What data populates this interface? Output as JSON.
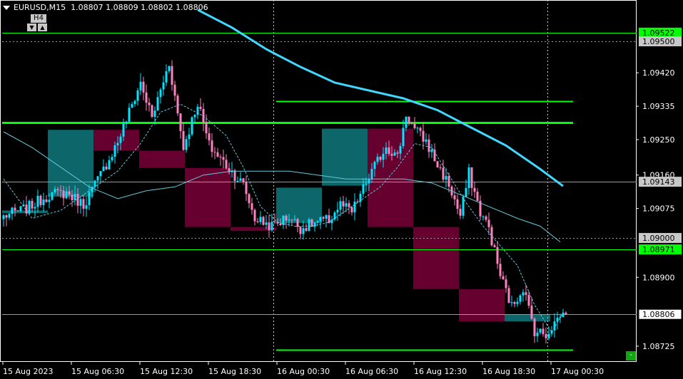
{
  "header": {
    "symbol": "EURUSD,M15",
    "ohlc": "1.08807 1.08809 1.08802 1.08806"
  },
  "timeframe": {
    "label": "H4",
    "down_glyph": "▼",
    "up_glyph": "▲"
  },
  "corner_button": {
    "label": "-"
  },
  "colors": {
    "background": "#000000",
    "axis_text": "#ffffff",
    "bull_candle": "#00e5ff",
    "bear_candle": "#ff80c0",
    "h4_bull_box": "#0d6b70",
    "h4_bear_box": "#6b0030",
    "level_green": "#00ff00",
    "ma_slow": "#40d8ff",
    "ma_mid": "#66c8dc",
    "ma_fast": "#66c8dc",
    "current_price_label": "#ffffff",
    "green_label_bg": "#00ff00"
  },
  "chart_data": {
    "type": "candlestick",
    "symbol": "EURUSD",
    "timeframe": "M15",
    "ylim": [
      1.08685,
      1.09605
    ],
    "x_tick_labels": [
      "15 Aug 2023",
      "15 Aug 06:30",
      "15 Aug 12:30",
      "15 Aug 18:30",
      "16 Aug 00:30",
      "16 Aug 06:30",
      "16 Aug 12:30",
      "16 Aug 18:30",
      "17 Aug 00:30"
    ],
    "y_tick_labels": [
      "1.09420",
      "1.09335",
      "1.09250",
      "1.09160",
      "1.09075",
      "1.08900",
      "1.08725"
    ],
    "price_labels": [
      {
        "text": "1.09522",
        "value": 1.09522,
        "style": "green"
      },
      {
        "text": "1.09500",
        "value": 1.095,
        "style": "white"
      },
      {
        "text": "1.09143",
        "value": 1.09143,
        "style": "white"
      },
      {
        "text": "1.09000",
        "value": 1.09,
        "style": "white"
      },
      {
        "text": "1.08971",
        "value": 1.08971,
        "style": "green"
      },
      {
        "text": "1.08806",
        "value": 1.08806,
        "style": "current"
      }
    ],
    "horizontal_levels": [
      {
        "value": 1.09522,
        "color": "#00ff00",
        "width": 1,
        "from_bar": 0,
        "to_bar": null
      },
      {
        "value": 1.095,
        "color": "#9a9a9a",
        "width": 1,
        "dash": true,
        "from_bar": 0,
        "to_bar": null
      },
      {
        "value": 1.09348,
        "color": "#00ff00",
        "width": 2,
        "from_bar": 96,
        "to_bar": 200
      },
      {
        "value": 1.09293,
        "color": "#00ff00",
        "width": 3,
        "from_bar": 0,
        "to_bar": 200
      },
      {
        "value": 1.09143,
        "color": "#9a9a9a",
        "width": 1,
        "from_bar": 0,
        "to_bar": null
      },
      {
        "value": 1.09,
        "color": "#9a9a9a",
        "width": 1,
        "dash": true,
        "from_bar": 0,
        "to_bar": null
      },
      {
        "value": 1.08971,
        "color": "#00ff00",
        "width": 1,
        "from_bar": 0,
        "to_bar": null
      },
      {
        "value": 1.08806,
        "color": "#9a9a9a",
        "width": 1,
        "from_bar": 0,
        "to_bar": null
      },
      {
        "value": 1.08715,
        "color": "#00ff00",
        "width": 2,
        "from_bar": 96,
        "to_bar": 200
      }
    ],
    "vertical_separators": [
      "16 Aug 00:00",
      "17 Aug 00:00"
    ],
    "h4_boxes": [
      {
        "open": 1.0907,
        "close": 1.09063,
        "bull": true
      },
      {
        "open": 1.09105,
        "close": 1.09275,
        "bull": true
      },
      {
        "open": 1.09275,
        "close": 1.09222,
        "bull": false
      },
      {
        "open": 1.09222,
        "close": 1.09178,
        "bull": false
      },
      {
        "open": 1.09178,
        "close": 1.09028,
        "bull": false
      },
      {
        "open": 1.09028,
        "close": 1.09018,
        "bull": false
      },
      {
        "open": 1.09038,
        "close": 1.09128,
        "bull": true
      },
      {
        "open": 1.09133,
        "close": 1.09278,
        "bull": true
      },
      {
        "open": 1.09278,
        "close": 1.09028,
        "bull": false
      },
      {
        "open": 1.09028,
        "close": 1.0887,
        "bull": false
      },
      {
        "open": 1.0887,
        "close": 1.08788,
        "bull": false
      },
      {
        "open": 1.08788,
        "close": 1.08806,
        "bull": true
      }
    ],
    "anchors": [
      [
        0,
        1.09055
      ],
      [
        8,
        1.09075
      ],
      [
        16,
        1.0911
      ],
      [
        22,
        1.09115
      ],
      [
        28,
        1.09085
      ],
      [
        34,
        1.0916
      ],
      [
        40,
        1.09245
      ],
      [
        48,
        1.09395
      ],
      [
        52,
        1.09305
      ],
      [
        58,
        1.09445
      ],
      [
        63,
        1.0923
      ],
      [
        68,
        1.09345
      ],
      [
        72,
        1.09235
      ],
      [
        78,
        1.09185
      ],
      [
        84,
        1.09135
      ],
      [
        88,
        1.0905
      ],
      [
        94,
        1.0903
      ],
      [
        100,
        1.09055
      ],
      [
        104,
        1.09025
      ],
      [
        110,
        1.0904
      ],
      [
        114,
        1.09045
      ],
      [
        118,
        1.09085
      ],
      [
        122,
        1.09065
      ],
      [
        128,
        1.09155
      ],
      [
        134,
        1.09235
      ],
      [
        138,
        1.09205
      ],
      [
        141,
        1.09315
      ],
      [
        144,
        1.09275
      ],
      [
        148,
        1.09245
      ],
      [
        152,
        1.09185
      ],
      [
        156,
        1.09135
      ],
      [
        160,
        1.09055
      ],
      [
        163,
        1.09165
      ],
      [
        167,
        1.09065
      ],
      [
        170,
        1.09025
      ],
      [
        174,
        1.08905
      ],
      [
        178,
        1.08825
      ],
      [
        182,
        1.08875
      ],
      [
        186,
        1.08765
      ],
      [
        190,
        1.08755
      ],
      [
        195,
        1.08805
      ],
      [
        197,
        1.08806
      ]
    ],
    "ma_slow": [
      [
        68,
        1.0958
      ],
      [
        80,
        1.09535
      ],
      [
        92,
        1.0948
      ],
      [
        104,
        1.09435
      ],
      [
        116,
        1.09395
      ],
      [
        128,
        1.09375
      ],
      [
        140,
        1.09355
      ],
      [
        152,
        1.09325
      ],
      [
        164,
        1.0928
      ],
      [
        176,
        1.09235
      ],
      [
        188,
        1.09175
      ],
      [
        196,
        1.09132
      ]
    ],
    "ma_mid": [
      [
        0,
        1.0927
      ],
      [
        10,
        1.0923
      ],
      [
        20,
        1.0918
      ],
      [
        30,
        1.0913
      ],
      [
        40,
        1.091
      ],
      [
        50,
        1.0912
      ],
      [
        60,
        1.0913
      ],
      [
        70,
        1.0916
      ],
      [
        80,
        1.0917
      ],
      [
        90,
        1.0917
      ],
      [
        100,
        1.0917
      ],
      [
        110,
        1.0916
      ],
      [
        120,
        1.0915
      ],
      [
        130,
        1.0915
      ],
      [
        140,
        1.0915
      ],
      [
        150,
        1.0914
      ],
      [
        160,
        1.0911
      ],
      [
        170,
        1.0908
      ],
      [
        180,
        1.0905
      ],
      [
        188,
        1.0903
      ],
      [
        195,
        1.0899
      ]
    ],
    "ma_fast": [
      [
        0,
        1.0915
      ],
      [
        10,
        1.0905
      ],
      [
        20,
        1.0907
      ],
      [
        30,
        1.0912
      ],
      [
        40,
        1.0917
      ],
      [
        48,
        1.0924
      ],
      [
        55,
        1.0932
      ],
      [
        62,
        1.0934
      ],
      [
        70,
        1.0931
      ],
      [
        78,
        1.0926
      ],
      [
        84,
        1.0918
      ],
      [
        90,
        1.0908
      ],
      [
        96,
        1.0904
      ],
      [
        102,
        1.0903
      ],
      [
        108,
        1.0903
      ],
      [
        114,
        1.0904
      ],
      [
        120,
        1.0907
      ],
      [
        126,
        1.091
      ],
      [
        132,
        1.0913
      ],
      [
        138,
        1.0918
      ],
      [
        144,
        1.0924
      ],
      [
        150,
        1.0923
      ],
      [
        156,
        1.0916
      ],
      [
        162,
        1.0909
      ],
      [
        168,
        1.0903
      ],
      [
        174,
        1.0898
      ],
      [
        180,
        1.0893
      ],
      [
        186,
        1.0883
      ],
      [
        192,
        1.0876
      ],
      [
        196,
        1.0881
      ]
    ]
  }
}
